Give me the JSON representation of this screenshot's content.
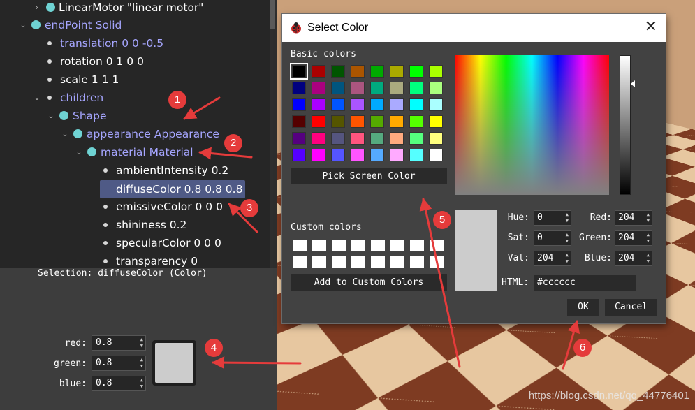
{
  "tree": {
    "rows": [
      {
        "text": "LinearMotor \"linear motor\"",
        "kind": "node"
      },
      {
        "text": "endPoint Solid",
        "kind": "node"
      },
      {
        "text": "translation 0 0 -0.5",
        "kind": "field"
      },
      {
        "text": "rotation 0 1 0 0",
        "kind": "field"
      },
      {
        "text": "scale 1 1 1",
        "kind": "field"
      },
      {
        "text": "children",
        "kind": "field"
      },
      {
        "text": "Shape",
        "kind": "node"
      },
      {
        "text": "appearance Appearance",
        "kind": "node"
      },
      {
        "text": "material Material",
        "kind": "node"
      },
      {
        "text": "ambientIntensity 0.2",
        "kind": "field"
      },
      {
        "text": "diffuseColor 0.8 0.8 0.8",
        "kind": "field",
        "selected": true
      },
      {
        "text": "emissiveColor 0 0 0",
        "kind": "field"
      },
      {
        "text": "shininess 0.2",
        "kind": "field"
      },
      {
        "text": "specularColor 0 0 0",
        "kind": "field"
      },
      {
        "text": "transparency 0",
        "kind": "field"
      }
    ]
  },
  "properties": {
    "selection": "Selection: diffuseColor (Color)",
    "red_label": "red:",
    "red_value": "0.8",
    "green_label": "green:",
    "green_value": "0.8",
    "blue_label": "blue:",
    "blue_value": "0.8",
    "swatch_color": "#cccccc"
  },
  "dialog": {
    "title": "Select Color",
    "basic_colors_label": "Basic colors",
    "basic_colors": [
      [
        "#000000",
        "#aa0000",
        "#005500",
        "#aa5500",
        "#00aa00",
        "#aaaa00",
        "#00ff00",
        "#aaff00"
      ],
      [
        "#00007f",
        "#aa007f",
        "#00557f",
        "#aa557f",
        "#00aa7f",
        "#aaaa7f",
        "#00ff7f",
        "#aaff7f"
      ],
      [
        "#0000ff",
        "#aa00ff",
        "#0055ff",
        "#aa55ff",
        "#00aaff",
        "#aaaaff",
        "#00ffff",
        "#aaffff"
      ],
      [
        "#550000",
        "#ff0000",
        "#555500",
        "#ff5500",
        "#55aa00",
        "#ffaa00",
        "#55ff00",
        "#ffff00"
      ],
      [
        "#55007f",
        "#ff007f",
        "#55557f",
        "#ff557f",
        "#55aa7f",
        "#ffaa7f",
        "#55ff7f",
        "#ffff7f"
      ],
      [
        "#5500ff",
        "#ff00ff",
        "#5555ff",
        "#ff55ff",
        "#55aaff",
        "#ffaaff",
        "#55ffff",
        "#ffffff"
      ]
    ],
    "pick_screen_label": "Pick Screen Color",
    "custom_colors_label": "Custom colors",
    "add_custom_label": "Add to Custom Colors",
    "hue_label": "Hue:",
    "hue": "0",
    "sat_label": "Sat:",
    "sat": "0",
    "val_label": "Val:",
    "val": "204",
    "red_label": "Red:",
    "red": "204",
    "green_label": "Green:",
    "green": "204",
    "blue_label": "Blue:",
    "blue": "204",
    "html_label": "HTML:",
    "html_value": "#cccccc",
    "ok_label": "OK",
    "cancel_label": "Cancel",
    "current_color": "#cccccc"
  },
  "annotations": [
    "1",
    "2",
    "3",
    "4",
    "5",
    "6"
  ],
  "watermark": "https://blog.csdn.net/qq_44776401"
}
